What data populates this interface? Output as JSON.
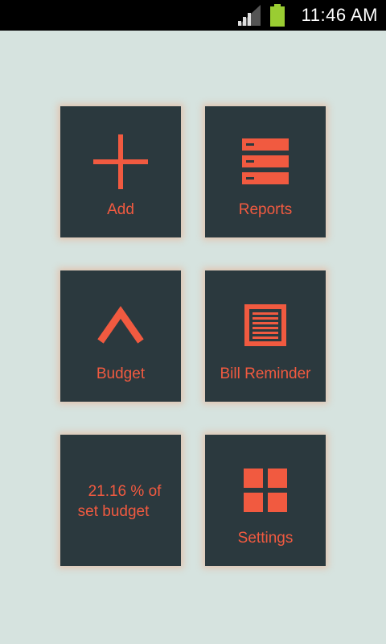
{
  "status_bar": {
    "time": "11:46 AM",
    "icons": [
      "signal-icon",
      "battery-icon"
    ]
  },
  "tiles": {
    "add": {
      "label": "Add",
      "icon": "plus-icon"
    },
    "reports": {
      "label": "Reports",
      "icon": "server-stack-icon"
    },
    "budget": {
      "label": "Budget",
      "icon": "chevron-up-icon"
    },
    "bill_reminder": {
      "label": "Bill Reminder",
      "icon": "document-lines-icon"
    },
    "budget_status": {
      "line1": "21.16 % of",
      "line2": "set budget"
    },
    "settings": {
      "label": "Settings",
      "icon": "grid-icon"
    }
  },
  "colors": {
    "background": "#d6e3df",
    "tile": "#2b393e",
    "accent": "#f15a40"
  }
}
